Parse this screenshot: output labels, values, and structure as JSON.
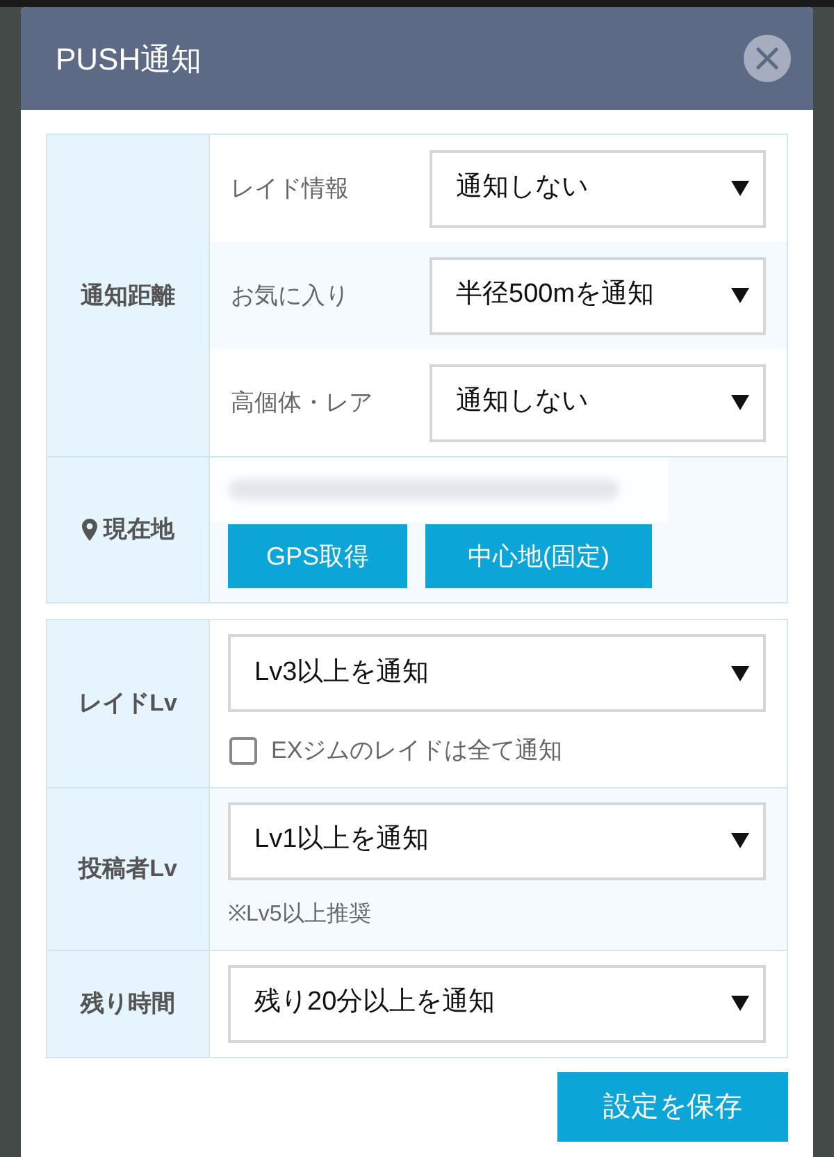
{
  "dialog": {
    "title": "PUSH通知"
  },
  "distance_section": {
    "label": "通知距離",
    "rows": [
      {
        "label": "レイド情報",
        "value": "通知しない"
      },
      {
        "label": "お気に入り",
        "value": "半径500mを通知"
      },
      {
        "label": "高個体・レア",
        "value": "通知しない"
      }
    ]
  },
  "location_section": {
    "label": "現在地",
    "buttons": [
      "GPS取得",
      "中心地(固定)"
    ]
  },
  "level_section": {
    "rows": [
      {
        "label": "レイドLv",
        "value": "Lv3以上を通知",
        "checkbox": {
          "label": "EXジムのレイドは全て通知",
          "checked": false
        }
      },
      {
        "label": "投稿者Lv",
        "value": "Lv1以上を通知",
        "note": "※Lv5以上推奨"
      },
      {
        "label": "残り時間",
        "value": "残り20分以上を通知"
      }
    ]
  },
  "save_button": "設定を保存"
}
